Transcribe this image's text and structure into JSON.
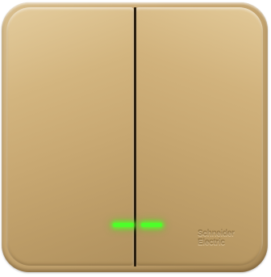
{
  "product": {
    "brand_line1": "Schneider",
    "brand_line2": "Electric",
    "finish_color": "#c9a873",
    "led_color": "#4dff2a"
  }
}
